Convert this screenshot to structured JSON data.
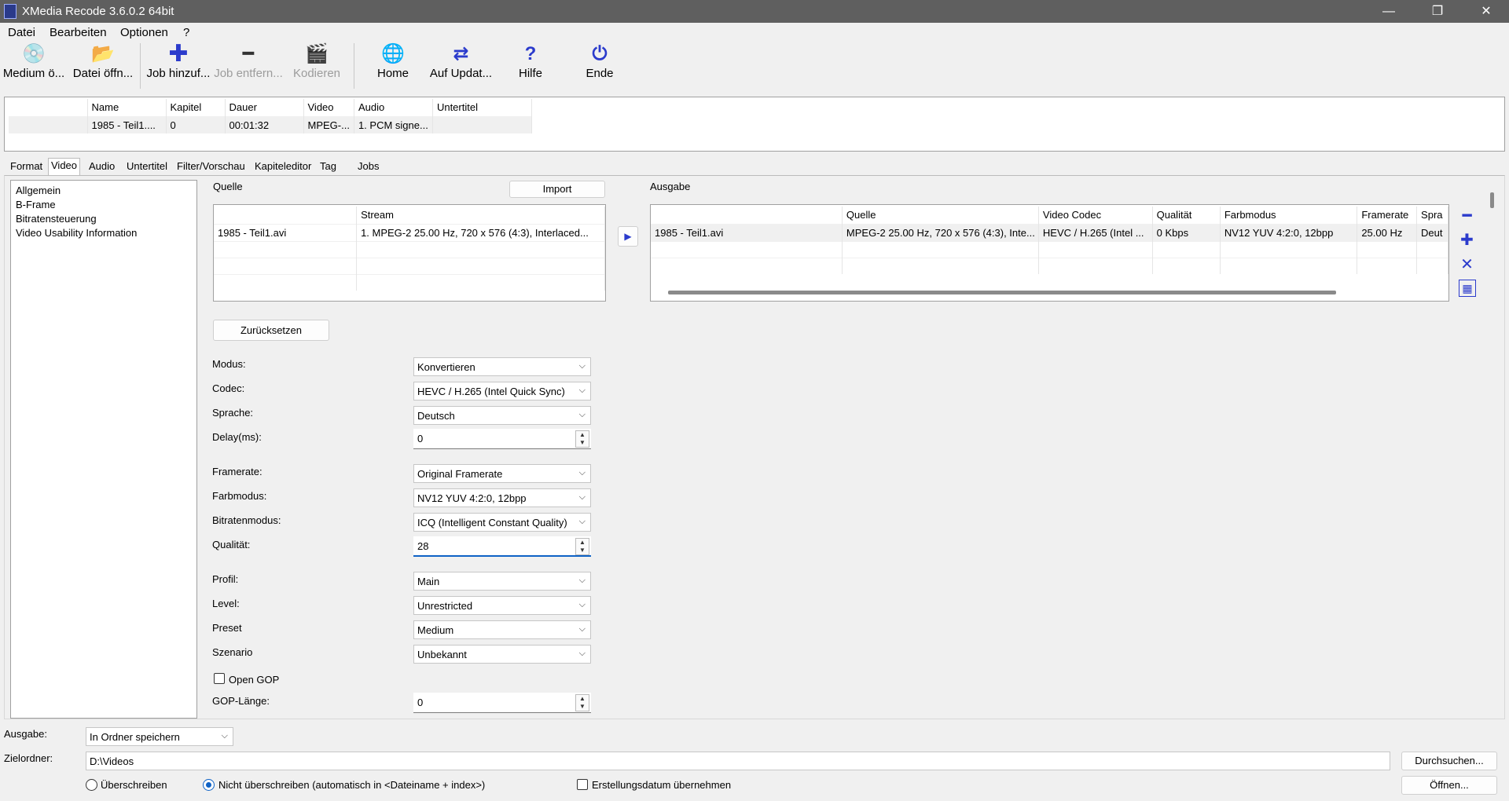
{
  "window": {
    "title": "XMedia Recode 3.6.0.2 64bit"
  },
  "menu": [
    "Datei",
    "Bearbeiten",
    "Optionen",
    "?"
  ],
  "toolbar": [
    {
      "label": "Medium ö...",
      "icon": "disc-icon",
      "enabled": true
    },
    {
      "label": "Datei öffn...",
      "icon": "folder-open-icon",
      "enabled": true
    },
    {
      "label": "Job hinzuf...",
      "icon": "plus-icon",
      "enabled": true
    },
    {
      "label": "Job entfern...",
      "icon": "minus-icon",
      "enabled": false
    },
    {
      "label": "Kodieren",
      "icon": "encode-icon",
      "enabled": false
    },
    {
      "label": "Home",
      "icon": "globe-icon",
      "enabled": true
    },
    {
      "label": "Auf Updat...",
      "icon": "refresh-icon",
      "enabled": true
    },
    {
      "label": "Hilfe",
      "icon": "question-icon",
      "enabled": true
    },
    {
      "label": "Ende",
      "icon": "power-icon",
      "enabled": true
    }
  ],
  "filelist": {
    "columns": [
      "Name",
      "Kapitel",
      "Dauer",
      "Video",
      "Audio",
      "Untertitel"
    ],
    "rows": [
      [
        "1985 - Teil1....",
        "0",
        "00:01:32",
        "MPEG-...",
        "1. PCM signe...",
        ""
      ]
    ]
  },
  "tabs": [
    "Format",
    "Video",
    "Audio",
    "Untertitel",
    "Filter/Vorschau",
    "Kapiteleditor",
    "Tag",
    "Jobs"
  ],
  "active_tab": "Video",
  "tree": [
    "Allgemein",
    "B-Frame",
    "Bitratensteuerung",
    "Video Usability Information"
  ],
  "source": {
    "label": "Quelle",
    "import_label": "Import",
    "columns": [
      "",
      "Stream"
    ],
    "rows": [
      [
        "1985 - Teil1.avi",
        "1. MPEG-2 25.00 Hz, 720 x 576 (4:3), Interlaced..."
      ]
    ]
  },
  "output": {
    "label": "Ausgabe",
    "columns": [
      "",
      "Quelle",
      "Video Codec",
      "Qualität",
      "Farbmodus",
      "Framerate",
      "Spra"
    ],
    "rows": [
      [
        "1985 - Teil1.avi",
        "MPEG-2 25.00 Hz, 720 x 576 (4:3), Inte...",
        "HEVC / H.265 (Intel ...",
        "0 Kbps",
        "NV12 YUV 4:2:0, 12bpp",
        "25.00 Hz",
        "Deut"
      ]
    ]
  },
  "reset_label": "Zurücksetzen",
  "form": {
    "modus": {
      "label": "Modus:",
      "value": "Konvertieren"
    },
    "codec": {
      "label": "Codec:",
      "value": "HEVC / H.265 (Intel Quick Sync)"
    },
    "sprache": {
      "label": "Sprache:",
      "value": "Deutsch"
    },
    "delay": {
      "label": "Delay(ms):",
      "value": "0"
    },
    "framerate": {
      "label": "Framerate:",
      "value": "Original Framerate"
    },
    "farbmodus": {
      "label": "Farbmodus:",
      "value": "NV12 YUV 4:2:0, 12bpp"
    },
    "bitratenmodus": {
      "label": "Bitratenmodus:",
      "value": "ICQ (Intelligent Constant Quality)"
    },
    "qualitaet": {
      "label": "Qualität:",
      "value": "28"
    },
    "profil": {
      "label": "Profil:",
      "value": "Main"
    },
    "level": {
      "label": "Level:",
      "value": "Unrestricted"
    },
    "preset": {
      "label": "Preset",
      "value": "Medium"
    },
    "szenario": {
      "label": "Szenario",
      "value": "Unbekannt"
    },
    "open_gop": {
      "label": "Open GOP",
      "checked": false
    },
    "gop_laenge": {
      "label": "GOP-Länge:",
      "value": "0"
    }
  },
  "bottom": {
    "ausgabe_label": "Ausgabe:",
    "ausgabe_value": "In Ordner speichern",
    "zielordner_label": "Zielordner:",
    "zielordner_value": "D:\\Videos",
    "browse_label": "Durchsuchen...",
    "open_label": "Öffnen...",
    "overwrite_label": "Überschreiben",
    "no_overwrite_label": "Nicht überschreiben (automatisch in <Dateiname + index>)",
    "creation_date_label": "Erstellungsdatum übernehmen",
    "selected_mode": "Nicht überschreiben"
  },
  "colors": {
    "titlebar": "#5f5f5f",
    "accent_icon": "#2b3bcc",
    "focus": "#0f62c5"
  }
}
